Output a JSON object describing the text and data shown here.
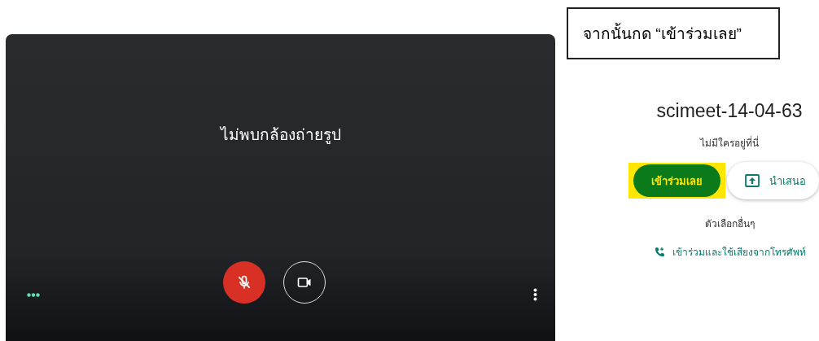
{
  "preview": {
    "message": "ไม่พบกล้องถ่ายรูป",
    "mic": {
      "muted": true
    }
  },
  "annotation": {
    "text": "จากนั้นกด “เข้าร่วมเลย”"
  },
  "meeting": {
    "title": "scimeet-14-04-63",
    "status": "ไม่มีใครอยู่ที่นี่",
    "join_button": {
      "label": "เข้าร่วมเลย",
      "highlighted": true
    },
    "present_button": {
      "label": "นำเสนอ"
    },
    "other_options": "ตัวเลือกอื่นๆ",
    "phone_link": "เข้าร่วมและใช้เสียงจากโทรศัพท์"
  }
}
